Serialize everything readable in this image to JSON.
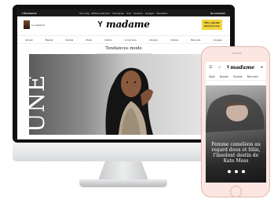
{
  "desktop": {
    "topbar": {
      "brand": "L'Évènement",
      "links": [
        "M le mag",
        "Éditions abonnés",
        "Chroniques",
        "Jeux",
        "Services",
        "Voyages",
        "Newsletter"
      ],
      "right": "Se connecter"
    },
    "header": {
      "magazine_label": "Le magazine",
      "logo": "madame",
      "logo_mark": "Y",
      "subscribe_label": "Offre spéciale\nabonnez-vous"
    },
    "nav": [
      "Accueil",
      "Beauté",
      "Société",
      "Mode",
      "Culture",
      "Art de vivre",
      "Lifestyle",
      "Cuisine",
      "Bien-être",
      "Voyages"
    ],
    "section_title": "Tendances mode",
    "hero": {
      "word": "UNE"
    }
  },
  "mobile": {
    "logo": "madame",
    "logo_mark": "Y",
    "nav": [
      "Style",
      "Beauté",
      "Société",
      "Bien-être"
    ],
    "headline": "Femme caméléon au regard doux et félin, l'insolent destin de Kate Moss"
  },
  "colors": {
    "subscribe": "#f5d33a",
    "phone_body": "#fbe6e2",
    "monitor": "#111111"
  }
}
